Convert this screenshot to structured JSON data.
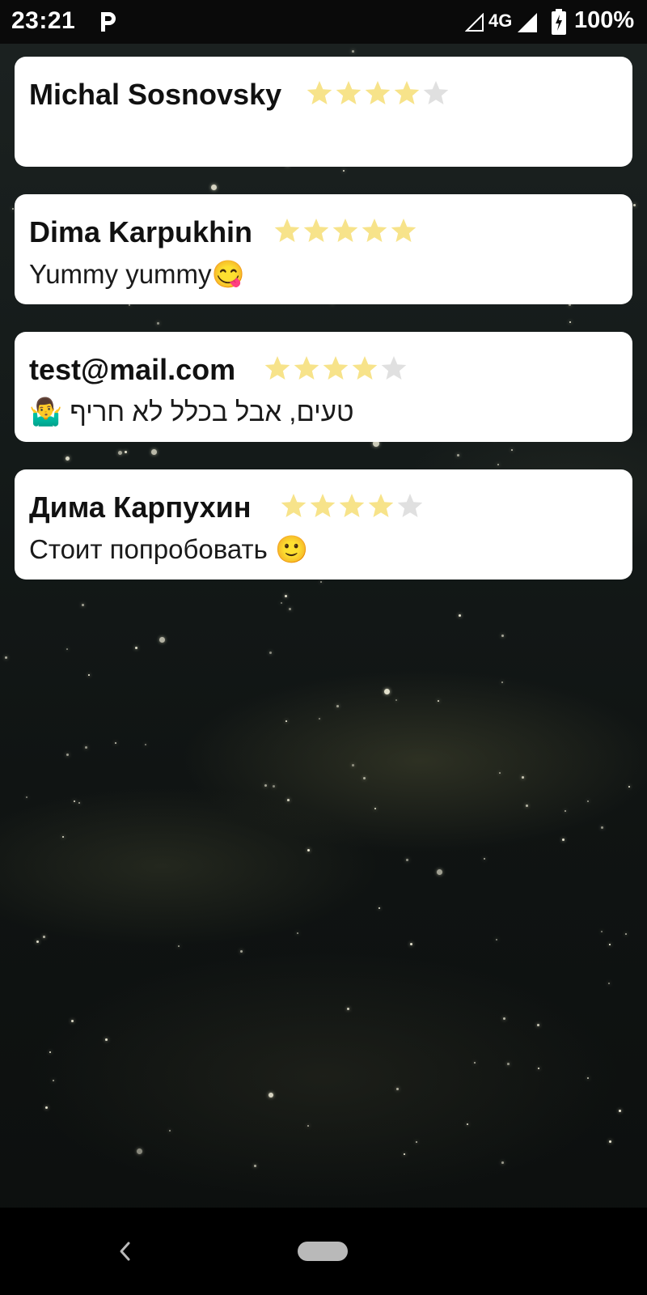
{
  "status_bar": {
    "time": "23:21",
    "app_icon": "p-letter-icon",
    "network": "4G",
    "battery": "100%"
  },
  "reviews": [
    {
      "name": "Michal Sosnovsky",
      "rating": 4,
      "max_rating": 5,
      "comment": ""
    },
    {
      "name": "Dima Karpukhin",
      "rating": 5,
      "max_rating": 5,
      "comment": "Yummy yummy😋"
    },
    {
      "name": "test@mail.com",
      "rating": 4,
      "max_rating": 5,
      "comment": "טעים, אבל בכלל לא חריף 🤷‍♂️"
    },
    {
      "name": "Дима Карпухин",
      "rating": 4,
      "max_rating": 5,
      "comment": "Стоит попробовать 🙂"
    }
  ],
  "colors": {
    "star_filled": "#f7e38a",
    "star_empty": "#e0e0e0",
    "card_background": "#ffffff"
  },
  "nav_bar": {
    "back_icon": "chevron-left-icon",
    "home_icon": "home-pill-icon"
  }
}
